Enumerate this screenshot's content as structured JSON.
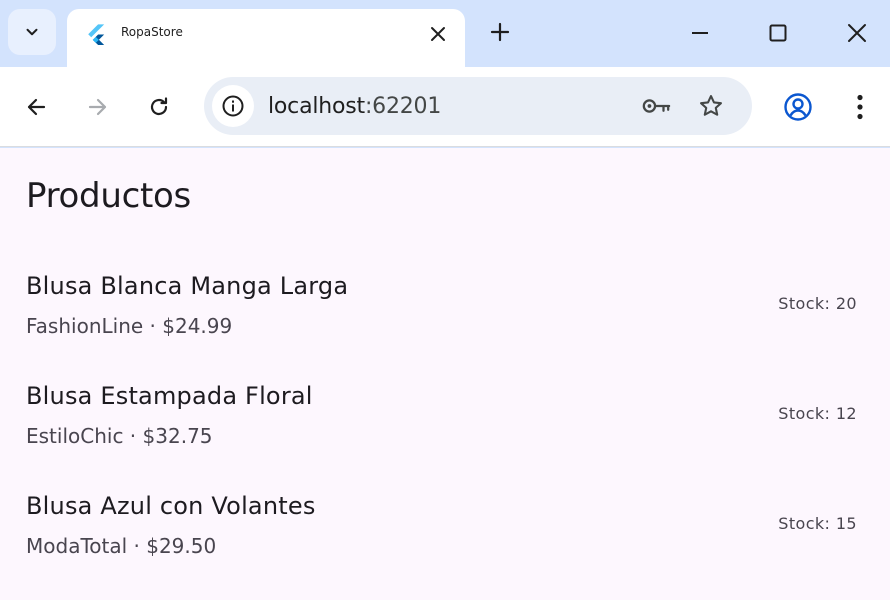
{
  "browser": {
    "tab": {
      "title": "RopaStore"
    },
    "address": {
      "host": "localhost",
      "port": ":62201"
    }
  },
  "page": {
    "title": "Productos",
    "products": [
      {
        "name": "Blusa Blanca Manga Larga",
        "brand": "FashionLine",
        "price": "$24.99",
        "stock": "Stock: 20"
      },
      {
        "name": "Blusa Estampada Floral",
        "brand": "EstiloChic",
        "price": "$32.75",
        "stock": "Stock: 12"
      },
      {
        "name": "Blusa Azul con Volantes",
        "brand": "ModaTotal",
        "price": "$29.50",
        "stock": "Stock: 15"
      }
    ],
    "separator": " · "
  },
  "colors": {
    "tabstrip": "#d3e3fd",
    "page_background": "#fdf7fe",
    "profile_accent": "#0b57d0"
  },
  "icons": [
    "tab-search-icon",
    "flutter-favicon-icon",
    "close-icon",
    "plus-icon",
    "minimize-icon",
    "maximize-icon",
    "close-window-icon",
    "back-arrow-icon",
    "forward-arrow-icon",
    "reload-icon",
    "info-icon",
    "key-icon",
    "star-icon",
    "profile-icon",
    "more-vert-icon"
  ]
}
